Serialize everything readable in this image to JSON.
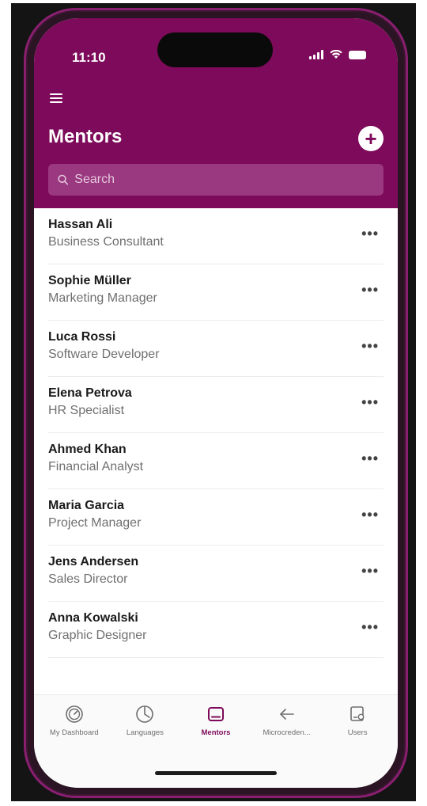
{
  "status": {
    "time": "11:10"
  },
  "header": {
    "title": "Mentors",
    "add_label": "+"
  },
  "search": {
    "placeholder": "Search"
  },
  "mentors": [
    {
      "name": "Hassan Ali",
      "role": "Business Consultant"
    },
    {
      "name": "Sophie Müller",
      "role": "Marketing Manager"
    },
    {
      "name": "Luca Rossi",
      "role": "Software Developer"
    },
    {
      "name": "Elena Petrova",
      "role": "HR Specialist"
    },
    {
      "name": "Ahmed Khan",
      "role": "Financial Analyst"
    },
    {
      "name": "Maria Garcia",
      "role": "Project Manager"
    },
    {
      "name": "Jens Andersen",
      "role": "Sales Director"
    },
    {
      "name": "Anna Kowalski",
      "role": "Graphic Designer"
    }
  ],
  "more_label": "•••",
  "tabs": [
    {
      "label": "My Dashboard",
      "icon": "gauge-icon"
    },
    {
      "label": "Languages",
      "icon": "pie-clock-icon"
    },
    {
      "label": "Mentors",
      "icon": "mentor-card-icon"
    },
    {
      "label": "Microcreden...",
      "icon": "arrow-left-icon"
    },
    {
      "label": "Users",
      "icon": "user-card-icon"
    }
  ],
  "colors": {
    "brand": "#7d0a5a",
    "search_bg": "#9a3880"
  }
}
